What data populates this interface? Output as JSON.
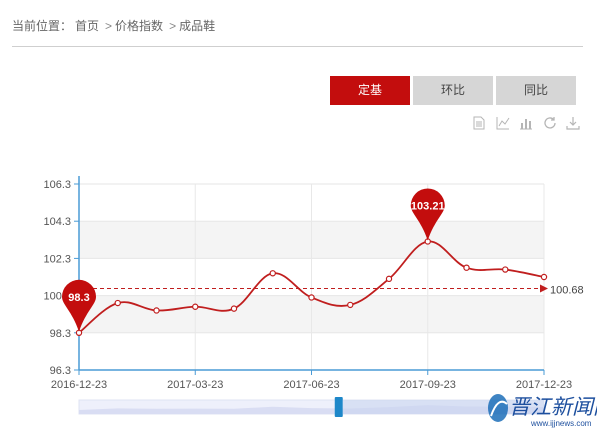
{
  "breadcrumb": {
    "prefix": "当前位置：",
    "items": [
      "首页",
      "价格指数",
      "成品鞋"
    ],
    "separator": ">"
  },
  "tabs": [
    {
      "label": "定基",
      "active": true
    },
    {
      "label": "环比",
      "active": false
    },
    {
      "label": "同比",
      "active": false
    }
  ],
  "toolbar": {
    "icons": [
      "data-view-icon",
      "line-chart-icon",
      "bar-chart-icon",
      "restore-icon",
      "download-icon"
    ]
  },
  "chart_data": {
    "type": "line",
    "title": "",
    "xlabel": "",
    "ylabel": "",
    "x": [
      "2016-12-23",
      "2017-01-23",
      "2017-02-23",
      "2017-03-23",
      "2017-04-23",
      "2017-05-23",
      "2017-06-23",
      "2017-07-23",
      "2017-08-23",
      "2017-09-23",
      "2017-10-23",
      "2017-11-23",
      "2017-12-23"
    ],
    "x_tick_labels": [
      "2016-12-23",
      "2017-03-23",
      "2017-06-23",
      "2017-09-23",
      "2017-12-23"
    ],
    "y_tick_labels": [
      "96.3",
      "98.3",
      "100.3",
      "102.3",
      "104.3",
      "106.3"
    ],
    "ylim": [
      96.3,
      106.3
    ],
    "series": [
      {
        "values": [
          98.3,
          99.9,
          99.5,
          99.7,
          99.6,
          101.5,
          100.2,
          99.8,
          101.2,
          103.21,
          101.8,
          101.7,
          101.3
        ]
      }
    ],
    "markers": {
      "max": "103.21",
      "min": "98.3"
    },
    "average_line": {
      "value": 100.68,
      "label": "100.68"
    },
    "grid": true,
    "colors": {
      "line": "#c01e1e",
      "accent": "#c30d0d",
      "axis": "#4a9bd6",
      "band": "#f4f4f4"
    },
    "zoom_slider": {
      "start_fraction": 0.0,
      "end_fraction": 1.0
    }
  },
  "watermark": {
    "text": "晋江新闻网",
    "url": "www.ijjnews.com"
  }
}
